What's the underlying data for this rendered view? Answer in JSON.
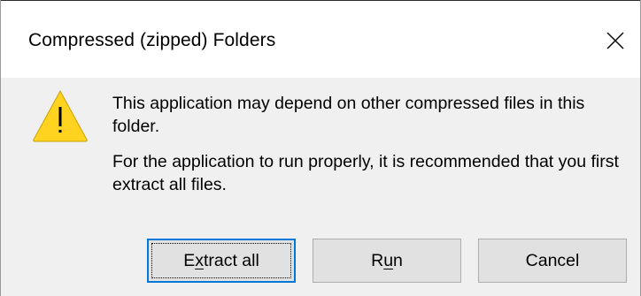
{
  "window": {
    "title": "Compressed (zipped) Folders",
    "close_icon": "close-icon"
  },
  "message": {
    "icon": "warning-icon",
    "line1": "This application may depend on other compressed files in this folder.",
    "line2": "For the application to run properly, it is recommended that you first extract all files."
  },
  "buttons": {
    "extract_pre": "E",
    "extract_accel": "x",
    "extract_post": "tract all",
    "run_pre": "R",
    "run_accel": "u",
    "run_post": "n",
    "cancel": "Cancel"
  },
  "colors": {
    "dialog_bg": "#f0f0f0",
    "title_bg": "#ffffff",
    "button_bg": "#e1e1e1",
    "default_button_border": "#0078d7",
    "warning_fill": "#ffd31f"
  }
}
